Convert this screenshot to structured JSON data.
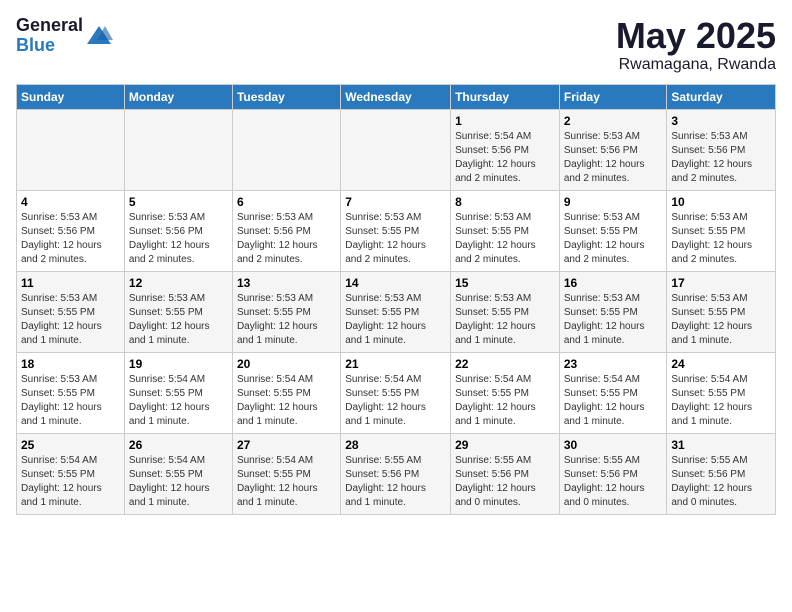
{
  "logo": {
    "general": "General",
    "blue": "Blue"
  },
  "title": "May 2025",
  "subtitle": "Rwamagana, Rwanda",
  "days_header": [
    "Sunday",
    "Monday",
    "Tuesday",
    "Wednesday",
    "Thursday",
    "Friday",
    "Saturday"
  ],
  "weeks": [
    [
      {
        "day": "",
        "info": ""
      },
      {
        "day": "",
        "info": ""
      },
      {
        "day": "",
        "info": ""
      },
      {
        "day": "",
        "info": ""
      },
      {
        "day": "1",
        "info": "Sunrise: 5:54 AM\nSunset: 5:56 PM\nDaylight: 12 hours\nand 2 minutes."
      },
      {
        "day": "2",
        "info": "Sunrise: 5:53 AM\nSunset: 5:56 PM\nDaylight: 12 hours\nand 2 minutes."
      },
      {
        "day": "3",
        "info": "Sunrise: 5:53 AM\nSunset: 5:56 PM\nDaylight: 12 hours\nand 2 minutes."
      }
    ],
    [
      {
        "day": "4",
        "info": "Sunrise: 5:53 AM\nSunset: 5:56 PM\nDaylight: 12 hours\nand 2 minutes."
      },
      {
        "day": "5",
        "info": "Sunrise: 5:53 AM\nSunset: 5:56 PM\nDaylight: 12 hours\nand 2 minutes."
      },
      {
        "day": "6",
        "info": "Sunrise: 5:53 AM\nSunset: 5:56 PM\nDaylight: 12 hours\nand 2 minutes."
      },
      {
        "day": "7",
        "info": "Sunrise: 5:53 AM\nSunset: 5:55 PM\nDaylight: 12 hours\nand 2 minutes."
      },
      {
        "day": "8",
        "info": "Sunrise: 5:53 AM\nSunset: 5:55 PM\nDaylight: 12 hours\nand 2 minutes."
      },
      {
        "day": "9",
        "info": "Sunrise: 5:53 AM\nSunset: 5:55 PM\nDaylight: 12 hours\nand 2 minutes."
      },
      {
        "day": "10",
        "info": "Sunrise: 5:53 AM\nSunset: 5:55 PM\nDaylight: 12 hours\nand 2 minutes."
      }
    ],
    [
      {
        "day": "11",
        "info": "Sunrise: 5:53 AM\nSunset: 5:55 PM\nDaylight: 12 hours\nand 1 minute."
      },
      {
        "day": "12",
        "info": "Sunrise: 5:53 AM\nSunset: 5:55 PM\nDaylight: 12 hours\nand 1 minute."
      },
      {
        "day": "13",
        "info": "Sunrise: 5:53 AM\nSunset: 5:55 PM\nDaylight: 12 hours\nand 1 minute."
      },
      {
        "day": "14",
        "info": "Sunrise: 5:53 AM\nSunset: 5:55 PM\nDaylight: 12 hours\nand 1 minute."
      },
      {
        "day": "15",
        "info": "Sunrise: 5:53 AM\nSunset: 5:55 PM\nDaylight: 12 hours\nand 1 minute."
      },
      {
        "day": "16",
        "info": "Sunrise: 5:53 AM\nSunset: 5:55 PM\nDaylight: 12 hours\nand 1 minute."
      },
      {
        "day": "17",
        "info": "Sunrise: 5:53 AM\nSunset: 5:55 PM\nDaylight: 12 hours\nand 1 minute."
      }
    ],
    [
      {
        "day": "18",
        "info": "Sunrise: 5:53 AM\nSunset: 5:55 PM\nDaylight: 12 hours\nand 1 minute."
      },
      {
        "day": "19",
        "info": "Sunrise: 5:54 AM\nSunset: 5:55 PM\nDaylight: 12 hours\nand 1 minute."
      },
      {
        "day": "20",
        "info": "Sunrise: 5:54 AM\nSunset: 5:55 PM\nDaylight: 12 hours\nand 1 minute."
      },
      {
        "day": "21",
        "info": "Sunrise: 5:54 AM\nSunset: 5:55 PM\nDaylight: 12 hours\nand 1 minute."
      },
      {
        "day": "22",
        "info": "Sunrise: 5:54 AM\nSunset: 5:55 PM\nDaylight: 12 hours\nand 1 minute."
      },
      {
        "day": "23",
        "info": "Sunrise: 5:54 AM\nSunset: 5:55 PM\nDaylight: 12 hours\nand 1 minute."
      },
      {
        "day": "24",
        "info": "Sunrise: 5:54 AM\nSunset: 5:55 PM\nDaylight: 12 hours\nand 1 minute."
      }
    ],
    [
      {
        "day": "25",
        "info": "Sunrise: 5:54 AM\nSunset: 5:55 PM\nDaylight: 12 hours\nand 1 minute."
      },
      {
        "day": "26",
        "info": "Sunrise: 5:54 AM\nSunset: 5:55 PM\nDaylight: 12 hours\nand 1 minute."
      },
      {
        "day": "27",
        "info": "Sunrise: 5:54 AM\nSunset: 5:55 PM\nDaylight: 12 hours\nand 1 minute."
      },
      {
        "day": "28",
        "info": "Sunrise: 5:55 AM\nSunset: 5:56 PM\nDaylight: 12 hours\nand 1 minute."
      },
      {
        "day": "29",
        "info": "Sunrise: 5:55 AM\nSunset: 5:56 PM\nDaylight: 12 hours\nand 0 minutes."
      },
      {
        "day": "30",
        "info": "Sunrise: 5:55 AM\nSunset: 5:56 PM\nDaylight: 12 hours\nand 0 minutes."
      },
      {
        "day": "31",
        "info": "Sunrise: 5:55 AM\nSunset: 5:56 PM\nDaylight: 12 hours\nand 0 minutes."
      }
    ]
  ]
}
